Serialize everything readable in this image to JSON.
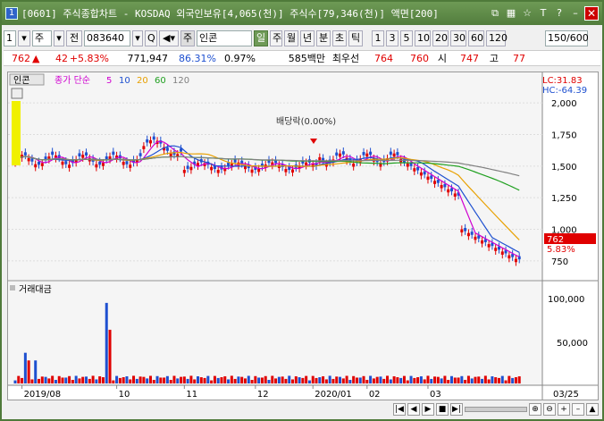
{
  "titlebar": {
    "num": "1",
    "text": "[0601] 주식종합차트 - KOSDAQ 외국인보유[4,065(천)] 주식수[79,346(천)] 액면[200]",
    "btn_link": "⧉",
    "btn_grid": "▦",
    "btn_star": "☆",
    "btn_t": "T",
    "btn_help": "?",
    "btn_min": "–",
    "btn_close": "✕"
  },
  "toolbar": {
    "idx": "1",
    "idx_drop": "▾",
    "type": "주",
    "type_drop": "▾",
    "all": "전",
    "code": "083640",
    "code_drop": "▾",
    "search": "Q",
    "sound": "◀▾",
    "stock_tag": "주",
    "stock_name": "인콘",
    "periods": [
      "일",
      "주",
      "월",
      "년",
      "분",
      "초",
      "틱"
    ],
    "selected_period": "일",
    "counts": [
      "1",
      "3",
      "5",
      "10",
      "20",
      "30",
      "60",
      "120"
    ],
    "view": "150/600"
  },
  "quote": {
    "price": "762",
    "arrow": "▲",
    "change": "42",
    "pct": "+5.83%",
    "volume": "771,947",
    "ratio1": "86.31%",
    "ratio2": "0.97%",
    "amount": "585백만",
    "best": "최우선",
    "bid": "764",
    "ask": "760",
    "open_label": "시",
    "open": "747",
    "high_label": "고",
    "high": "77"
  },
  "chart": {
    "stock_tab": "인콘",
    "ma_label": "종가 단순",
    "ma": [
      "5",
      "10",
      "20",
      "60",
      "120"
    ],
    "hc": "HC:-64.39",
    "lc": "LC:31.83",
    "y_ticks": [
      "2,000",
      "1,750",
      "1,500",
      "1,250",
      "1,000",
      "750"
    ],
    "price_tag": "762",
    "price_pct": "5.83%",
    "annotation": "배당락(0.00%)",
    "vol_title": "거래대금",
    "vol_ticks": [
      "100,000",
      "50,000"
    ],
    "x_labels": [
      "2019/08",
      "10",
      "11",
      "12",
      "2020/01",
      "02",
      "03"
    ],
    "right_date": "03/25",
    "colors": {
      "up": "#e00000",
      "down": "#1e50d0",
      "ma5": "#d000d0",
      "ma10": "#1e50d0",
      "ma20": "#e8a000",
      "ma60": "#20a020",
      "ma120": "#808080"
    }
  },
  "bottombar": {
    "nav": [
      "|◀",
      "◀",
      "▶",
      "■",
      "▶|"
    ],
    "tools": [
      "⊕",
      "⊖",
      "+",
      "–",
      "▲"
    ]
  }
}
